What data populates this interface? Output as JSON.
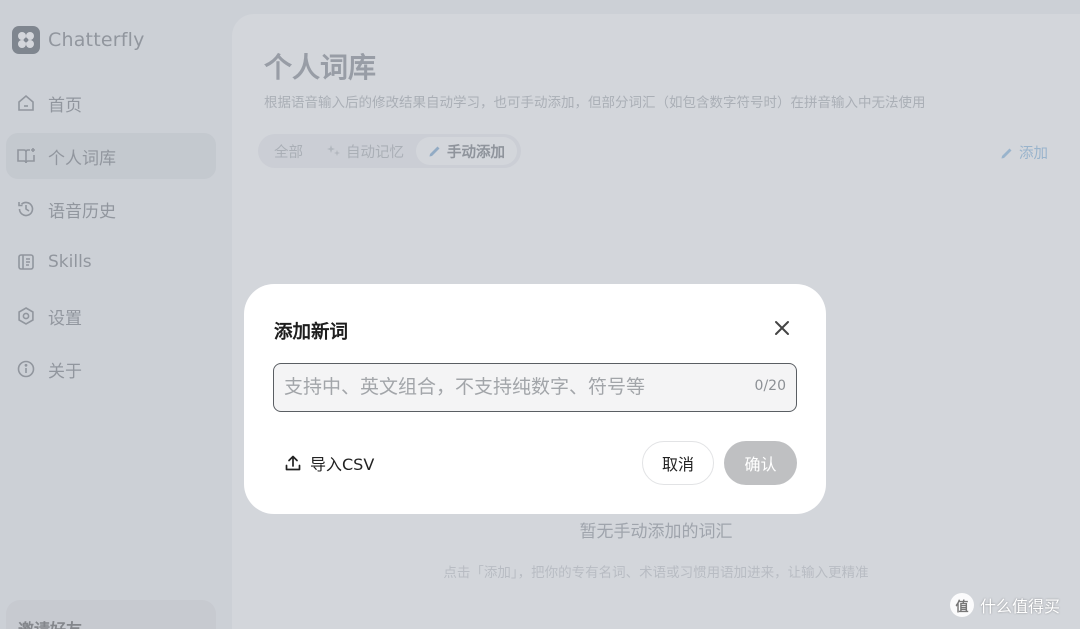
{
  "app": {
    "name": "Chatterfly"
  },
  "sidebar": {
    "items": [
      {
        "label": "首页",
        "icon": "home-icon"
      },
      {
        "label": "个人词库",
        "icon": "book-icon",
        "active": true
      },
      {
        "label": "语音历史",
        "icon": "history-icon"
      },
      {
        "label": "Skills",
        "icon": "skills-icon"
      },
      {
        "label": "设置",
        "icon": "settings-icon"
      },
      {
        "label": "关于",
        "icon": "info-icon"
      }
    ],
    "invite_label": "邀请好友"
  },
  "page": {
    "title": "个人词库",
    "description": "根据语音输入后的修改结果自动学习，也可手动添加，但部分词汇（如包含数字符号时）在拼音输入中无法使用",
    "tabs": [
      {
        "label": "全部"
      },
      {
        "label": "自动记忆"
      },
      {
        "label": "手动添加",
        "active": true
      }
    ],
    "add_label": "添加",
    "empty_title": "暂无手动添加的词汇",
    "empty_desc": "点击「添加」，把你的专有名词、术语或习惯用语加进来，让输入更精准"
  },
  "dialog": {
    "title": "添加新词",
    "input_placeholder": "支持中、英文组合，不支持纯数字、符号等",
    "input_value": "",
    "counter": "0/20",
    "import_label": "导入CSV",
    "cancel_label": "取消",
    "confirm_label": "确认"
  },
  "watermark": {
    "logo": "值",
    "text": "什么值得买"
  },
  "colors": {
    "overlay": "#969eaa",
    "confirm_disabled": "#bfc0c2",
    "link_blue": "#9cc4e6"
  }
}
